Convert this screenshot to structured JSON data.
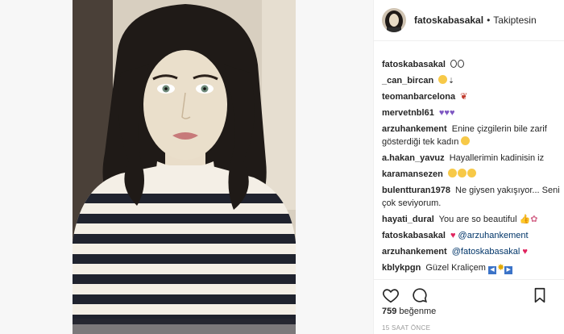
{
  "header": {
    "username": "fatoskabasakal",
    "separator": "•",
    "follow_label": "Takiptesin"
  },
  "comments": [
    {
      "user": "fatoskabasakal",
      "text": "",
      "emoji": [
        "eyes"
      ]
    },
    {
      "user": "_can_bircan",
      "text": "",
      "emoji": [
        "heart-eyes"
      ]
    },
    {
      "user": "teomanbarcelona",
      "text": "",
      "emoji": [
        "rose"
      ]
    },
    {
      "user": "mervetnbl61",
      "text": "",
      "emoji": [
        "purple-heart",
        "purple-heart",
        "purple-heart"
      ]
    },
    {
      "user": "arzuhankement",
      "text": "Enine çizgilerin bile zarif gösterdiği tek kadın",
      "emoji": [
        "heart-eyes"
      ]
    },
    {
      "user": "a.hakan_yavuz",
      "text": "Hayallerimin kadinisin iz",
      "emoji": []
    },
    {
      "user": "karamansezen",
      "text": "",
      "emoji": [
        "kiss-face",
        "kiss-face",
        "kiss-face"
      ]
    },
    {
      "user": "bulentturan1978",
      "text": "Ne giysen yakışıyor... Seni çok seviyorum.",
      "emoji": []
    },
    {
      "user": "hayati_dural",
      "text": "You are so beautiful",
      "emoji": [
        "thumbs-up",
        "tulip"
      ]
    },
    {
      "user": "fatoskabasakal",
      "text": "",
      "emoji": [
        "red-heart"
      ],
      "mention": "@arzuhankement"
    },
    {
      "user": "arzuhankement",
      "mention": "@fatoskabasakal",
      "text": "",
      "emoji": [
        "red-heart"
      ]
    },
    {
      "user": "kblykpgn",
      "text": "Güzel Kraliçem",
      "emoji": [
        "play-left",
        "sun",
        "play-right"
      ]
    }
  ],
  "actions": {
    "like_icon": "heart-outline-icon",
    "comment_icon": "speech-bubble-icon",
    "save_icon": "bookmark-icon"
  },
  "likes": {
    "count": "759",
    "label": "beğenme"
  },
  "time": "15 SAAT ÖNCE",
  "colors": {
    "text": "#262626",
    "mention": "#003569",
    "muted": "#999999",
    "heart_red": "#e0245e",
    "heart_purple": "#7e57c2"
  }
}
